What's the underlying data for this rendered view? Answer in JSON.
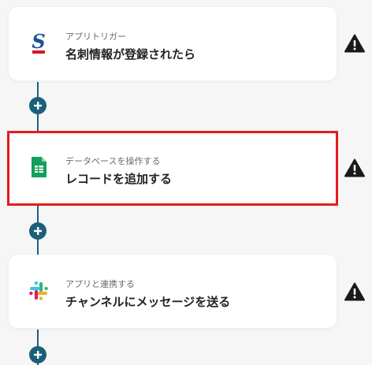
{
  "steps": [
    {
      "subtitle": "アプリトリガー",
      "title": "名刺情報が登録されたら",
      "app_icon": "sansan-logo"
    },
    {
      "subtitle": "データベースを操作する",
      "title": "レコードを追加する",
      "app_icon": "google-sheets-icon"
    },
    {
      "subtitle": "アプリと連携する",
      "title": "チャンネルにメッセージを送る",
      "app_icon": "slack-icon"
    }
  ],
  "warning_icon": "warning-icon",
  "add_icon": "plus-icon",
  "colors": {
    "connector": "#1c5f7a",
    "selection": "#e51c1c",
    "background": "#f6f6f6",
    "card": "#ffffff"
  }
}
